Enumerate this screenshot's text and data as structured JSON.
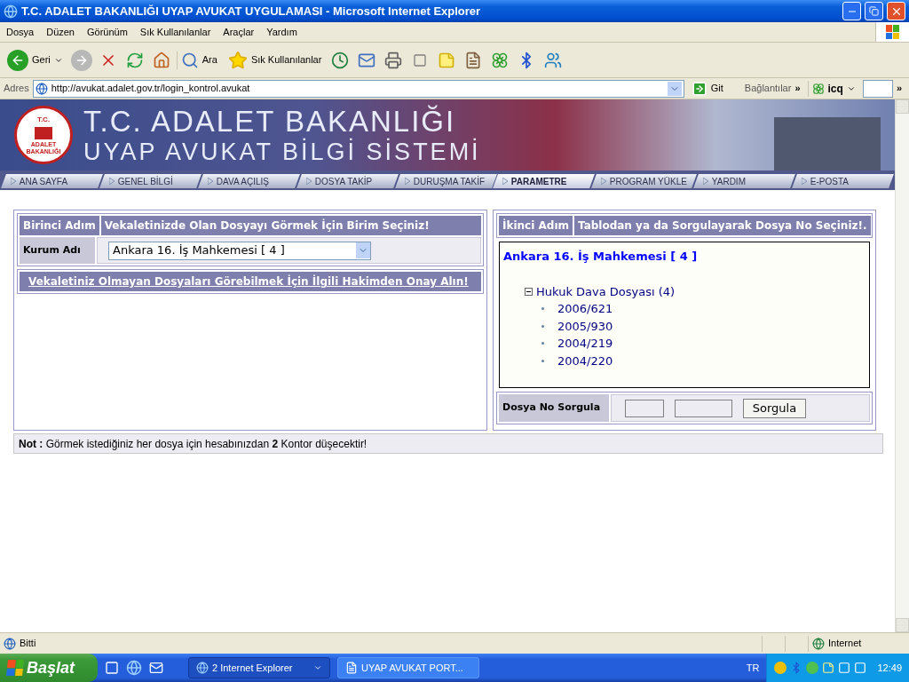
{
  "window": {
    "title": "T.C. ADALET BAKANLIĞI UYAP AVUKAT UYGULAMASI - Microsoft Internet Explorer"
  },
  "menu": [
    "Dosya",
    "Düzen",
    "Görünüm",
    "Sık Kullanılanlar",
    "Araçlar",
    "Yardım"
  ],
  "toolbar": {
    "back": "Geri",
    "search": "Ara",
    "favorites": "Sık Kullanılanlar"
  },
  "address_bar": {
    "label": "Adres",
    "url": "http://avukat.adalet.gov.tr/login_kontrol.avukat",
    "go": "Git",
    "links": "Bağlantılar",
    "links_more": "»",
    "icq": "icq",
    "toolbar_more": "»"
  },
  "banner": {
    "logo_top": "T.C.",
    "logo_ring": "ADALET BAKANLIĞI",
    "title": "T.C. ADALET BAKANLIĞI",
    "subtitle": "UYAP AVUKAT BİLGİ SİSTEMİ"
  },
  "nav_tabs": [
    {
      "label": "ANA SAYFA",
      "selected": false
    },
    {
      "label": "GENEL BİLGİ",
      "selected": false
    },
    {
      "label": "DAVA AÇILIŞ",
      "selected": false
    },
    {
      "label": "DOSYA TAKİP",
      "selected": false
    },
    {
      "label": "DURUŞMA TAKİF",
      "selected": false
    },
    {
      "label": "PARAMETRE",
      "selected": true
    },
    {
      "label": "PROGRAM YÜKLE",
      "selected": false
    },
    {
      "label": "YARDIM",
      "selected": false
    },
    {
      "label": "E-POSTA",
      "selected": false
    }
  ],
  "step1": {
    "step": "Birinci Adım",
    "instruction": "Vekaletinizde Olan Dosyayı Görmek İçin Birim Seçiniz!",
    "field_label": "Kurum Adı",
    "selected_unit": "Ankara 16. İş Mahkemesi [ 4 ]",
    "approval_link": "Vekaletiniz Olmayan Dosyaları Görebilmek İçin İlgili Hakimden Onay Alın!"
  },
  "step2": {
    "step": "İkinci Adım",
    "instruction": "Tablodan ya da Sorgulayarak Dosya No Seçiniz!.",
    "tree_title": "Ankara 16. İş Mahkemesi [ 4 ]",
    "tree": [
      {
        "label": "Hukuk Dava Dosyası (4)",
        "expanded": true,
        "children": [
          {
            "label": "2006/621"
          },
          {
            "label": "2005/930"
          },
          {
            "label": "2004/219"
          },
          {
            "label": "2004/220"
          }
        ]
      }
    ],
    "query_label": "Dosya No Sorgula",
    "query_button": "Sorgula"
  },
  "note": "**Not :** Görmek istediğiniz her dosya için hesabınızdan **2** Kontor düşecektir!",
  "status_bar": {
    "text": "Bitti",
    "zone": "Internet"
  },
  "taskbar": {
    "start": "Başlat",
    "tasks": [
      {
        "label": "2 Internet Explorer",
        "selected": true
      },
      {
        "label": "UYAP AVUKAT PORT...",
        "selected": false
      }
    ],
    "language": "TR",
    "clock": "12:49"
  }
}
